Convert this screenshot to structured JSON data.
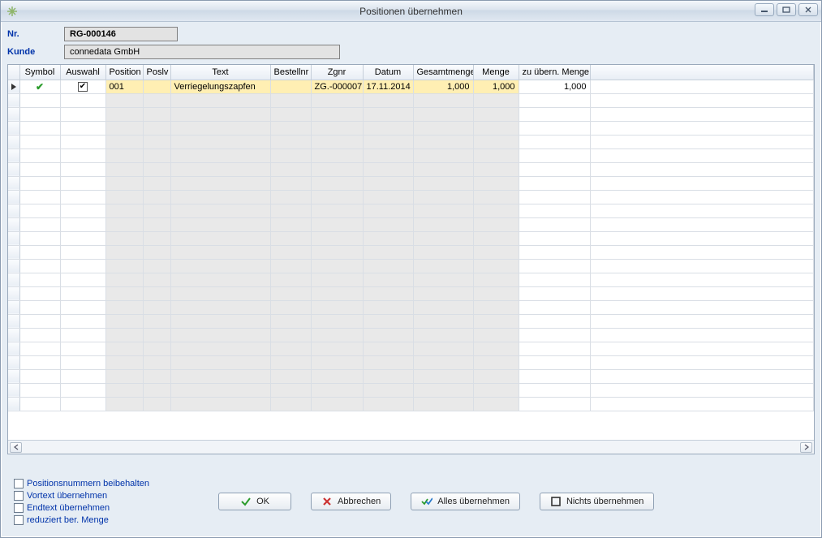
{
  "window": {
    "title": "Positionen übernehmen"
  },
  "header": {
    "nr_label": "Nr.",
    "nr_value": "RG-000146",
    "kunde_label": "Kunde",
    "kunde_value": "connedata GmbH"
  },
  "grid": {
    "columns": {
      "symbol": "Symbol",
      "auswahl": "Auswahl",
      "position": "Position",
      "poslv": "Poslv",
      "text": "Text",
      "bestellnr": "Bestellnr",
      "zgnr": "Zgnr",
      "datum": "Datum",
      "gesamtmenge": "Gesamtmenge",
      "menge": "Menge",
      "zuubern": "zu übern. Menge"
    },
    "rows": [
      {
        "selected": true,
        "auswahl_checked": true,
        "position": "001",
        "poslv": "",
        "text": "Verriegelungszapfen",
        "bestellnr": "",
        "zgnr": "ZG.-000007",
        "datum": "17.11.2014",
        "gesamtmenge": "1,000",
        "menge": "1,000",
        "zuubern": "1,000"
      }
    ]
  },
  "options": {
    "keep_posnr": "Positionsnummern beibehalten",
    "vortext": "Vortext übernehmen",
    "endtext": "Endtext übernehmen",
    "reduziert": "reduziert ber. Menge"
  },
  "buttons": {
    "ok": "OK",
    "cancel": "Abbrechen",
    "take_all": "Alles übernehmen",
    "take_none": "Nichts übernehmen"
  }
}
